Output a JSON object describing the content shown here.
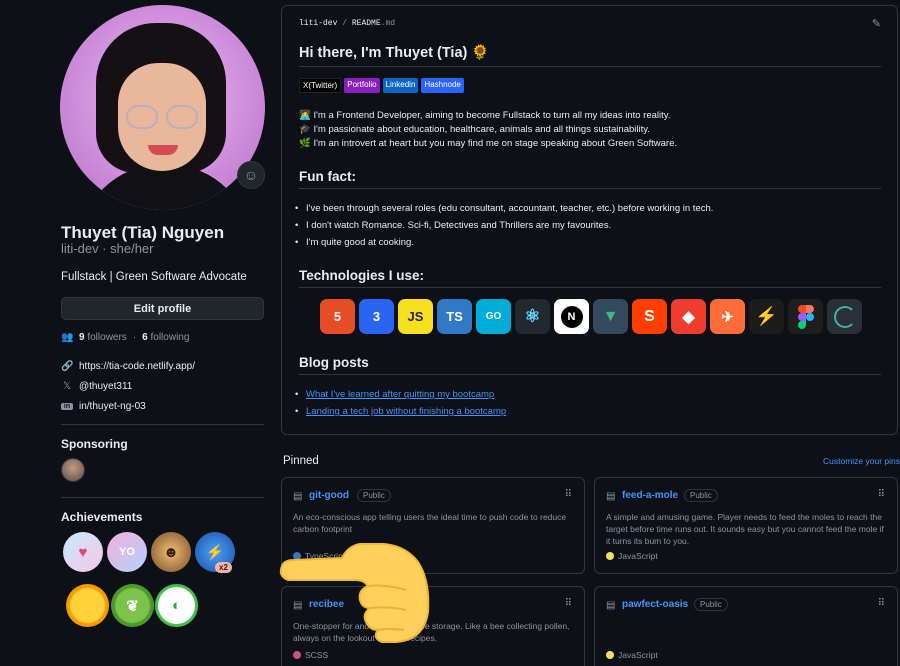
{
  "profile": {
    "name": "Thuyet (Tia) Nguyen",
    "login": "liti-dev · she/her",
    "bio": "Fullstack | Green Software Advocate",
    "edit_label": "Edit profile",
    "followers_count": "9",
    "followers_label": "followers",
    "following_count": "6",
    "following_label": "following",
    "website": "https://tia-code.netlify.app/",
    "twitter": "@thuyet311",
    "linkedin": "in/thuyet-ng-03",
    "sponsoring_title": "Sponsoring",
    "achievements_title": "Achievements",
    "achievement_multiplier": "x2"
  },
  "readme": {
    "crumb_user": "liti-dev",
    "crumb_sep": "/",
    "crumb_file": "README",
    "crumb_ext": ".md",
    "title": "Hi there, I'm Thuyet (Tia) 🌻",
    "shields": [
      "X(Twitter)",
      "Portfolio",
      "Linkedin",
      "Hashnode"
    ],
    "intro": [
      "👩‍💻 I'm a Frontend Developer, aiming to become Fullstack to turn all my ideas into reality.",
      "🎓 I'm passionate about education, healthcare, animals and all things sustainability.",
      "🌿 I'm an introvert at heart but you may find me on stage speaking about Green Software."
    ],
    "fun_fact_title": "Fun fact:",
    "fun_facts": [
      "I've been through several roles (edu consultant, accountant, teacher, etc.) before working in tech.",
      "I don't watch Romance. Sci-fi, Detectives and Thrillers are my favourites.",
      "I'm quite good at cooking."
    ],
    "tech_title": "Technologies I use:",
    "techs": [
      "HTML5",
      "CSS3",
      "JS",
      "TS",
      "GO",
      "React",
      "Next.js",
      "Vue",
      "Svelte",
      "Git",
      "Postman",
      "Supabase",
      "Figma",
      "Loading"
    ],
    "blog_title": "Blog posts",
    "blog_posts": [
      "What I've learned after quitting my bootcamp",
      "Landing a tech job without finishing a bootcamp"
    ]
  },
  "pinned": {
    "title": "Pinned",
    "customize": "Customize your pins",
    "repos": [
      {
        "name": "git-good",
        "visibility": "Public",
        "description": "An eco-conscious app telling users the ideal time to push code to reduce carbon footprint",
        "language": "TypeScript",
        "lang_color": "#3178c6"
      },
      {
        "name": "feed-a-mole",
        "visibility": "Public",
        "description": "A simple and amusing game. Player needs to feed the moles to reach the target before time runs out. It sounds easy but you cannot feed the mole if it turns its bum to you.",
        "language": "JavaScript",
        "lang_color": "#f1e05a"
      },
      {
        "name": "recibee",
        "visibility": "",
        "description": "One-stopper for and personal recipe storage. Like a bee collecting pollen, always on the lookout for new recipes.",
        "language": "SCSS",
        "lang_color": "#c6538c"
      },
      {
        "name": "pawfect-oasis",
        "visibility": "Public",
        "description": "",
        "language": "JavaScript",
        "lang_color": "#f1e05a"
      }
    ]
  }
}
